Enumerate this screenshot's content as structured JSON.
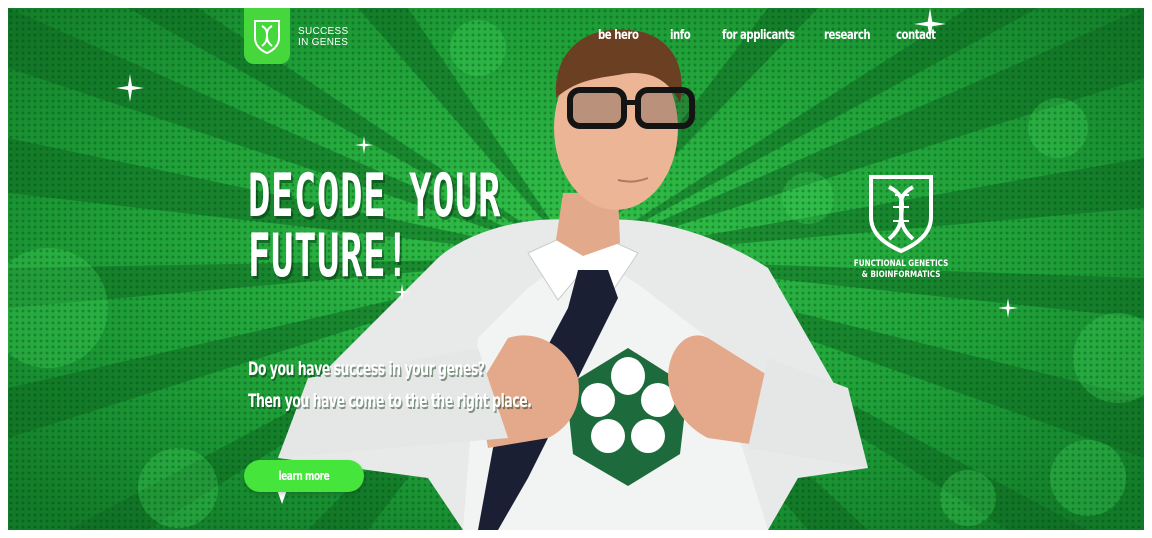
{
  "brand": {
    "line1": "SUCCESS",
    "line2": "IN GENES",
    "logo_icon": "dna-shield-icon",
    "accent_color": "#46e53b",
    "background_color": "#1fa83a"
  },
  "nav": {
    "items": [
      {
        "label": "be hero"
      },
      {
        "label": "info"
      },
      {
        "label": "for applicants"
      },
      {
        "label": "research"
      },
      {
        "label": "contact"
      }
    ]
  },
  "hero": {
    "headline_line1": "DECODE YOUR",
    "headline_line2": "FUTURE!",
    "sub_line1": "Do you have success in your genes?",
    "sub_line2": "Then you have come to the the right place.",
    "cta_label": "learn more"
  },
  "department": {
    "line1": "FUNCTIONAL GENETICS",
    "line2": "& BIOINFORMATICS",
    "icon": "dna-shield-icon"
  },
  "chest_emblem": {
    "icon": "petal-flower-icon",
    "color": "#1d6b3c"
  }
}
